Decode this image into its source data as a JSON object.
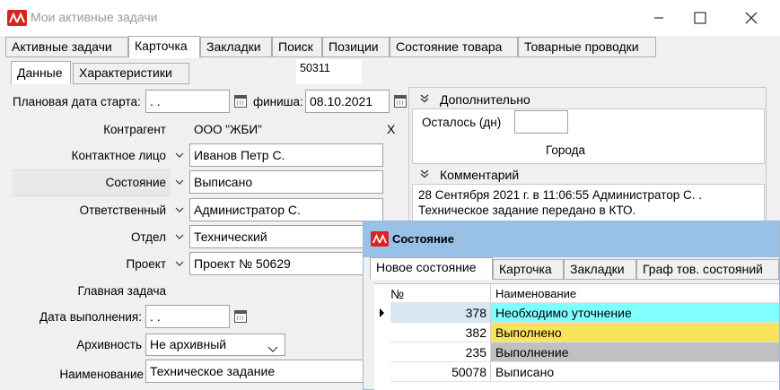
{
  "window": {
    "title": "Мои активные задачи",
    "minimize_icon": "minimize-icon",
    "maximize_icon": "maximize-icon",
    "close_icon": "close-icon"
  },
  "main_tabs": [
    "Активные задачи",
    "Карточка",
    "Закладки",
    "Поиск",
    "Позиции",
    "Состояние товара",
    "Товарные проводки"
  ],
  "sub_tabs": [
    "Данные",
    "Характеристики"
  ],
  "task_number": "50311",
  "form": {
    "start_date_label": "Плановая дата старта:",
    "start_date_value": " .  .",
    "finish_label": "финиша:",
    "finish_value": "08.10.2021",
    "counterparty_label": "Контрагент",
    "counterparty_value": "ООО \"ЖБИ\"",
    "counterparty_clear": "X",
    "contact_label": "Контактное лицо",
    "contact_value": "Иванов Петр С.",
    "state_label": "Состояние",
    "state_value": "Выписано",
    "responsible_label": "Ответственный",
    "responsible_value": "Администратор С.",
    "department_label": "Отдел",
    "department_value": "Технический",
    "project_label": "Проект",
    "project_value": "Проект № 50629",
    "main_task_label": "Главная задача",
    "due_date_label": "Дата выполнения:",
    "due_date_value": " .  .",
    "archive_label": "Архивность",
    "archive_value": "Не архивный",
    "name_label": "Наименование",
    "name_value": "Техническое задание"
  },
  "extra": {
    "header": "Дополнительно",
    "days_left_label": "Осталось (дн)",
    "days_left_value": "",
    "cities_label": "Города"
  },
  "comment": {
    "header": "Комментарий",
    "line1": "28 Сентября 2021 г. в 11:06:55 Администратор С. .",
    "line2": "Техническое задание передано в КТО."
  },
  "dialog": {
    "title": "Состояние",
    "tabs": [
      "Новое состояние",
      "Карточка",
      "Закладки",
      "Граф тов. состояний"
    ],
    "columns": {
      "num": "№",
      "name": "Наименование"
    },
    "rows": [
      {
        "num": "378",
        "name": "Необходимо уточнение",
        "color": "#80ffff",
        "current": true
      },
      {
        "num": "382",
        "name": "Выполнено",
        "color": "#f8e45a",
        "current": false
      },
      {
        "num": "235",
        "name": "Выполнение",
        "color": "#c0c0c0",
        "current": false
      },
      {
        "num": "50078",
        "name": "Выписано",
        "color": "#ffffff",
        "current": false
      }
    ]
  }
}
